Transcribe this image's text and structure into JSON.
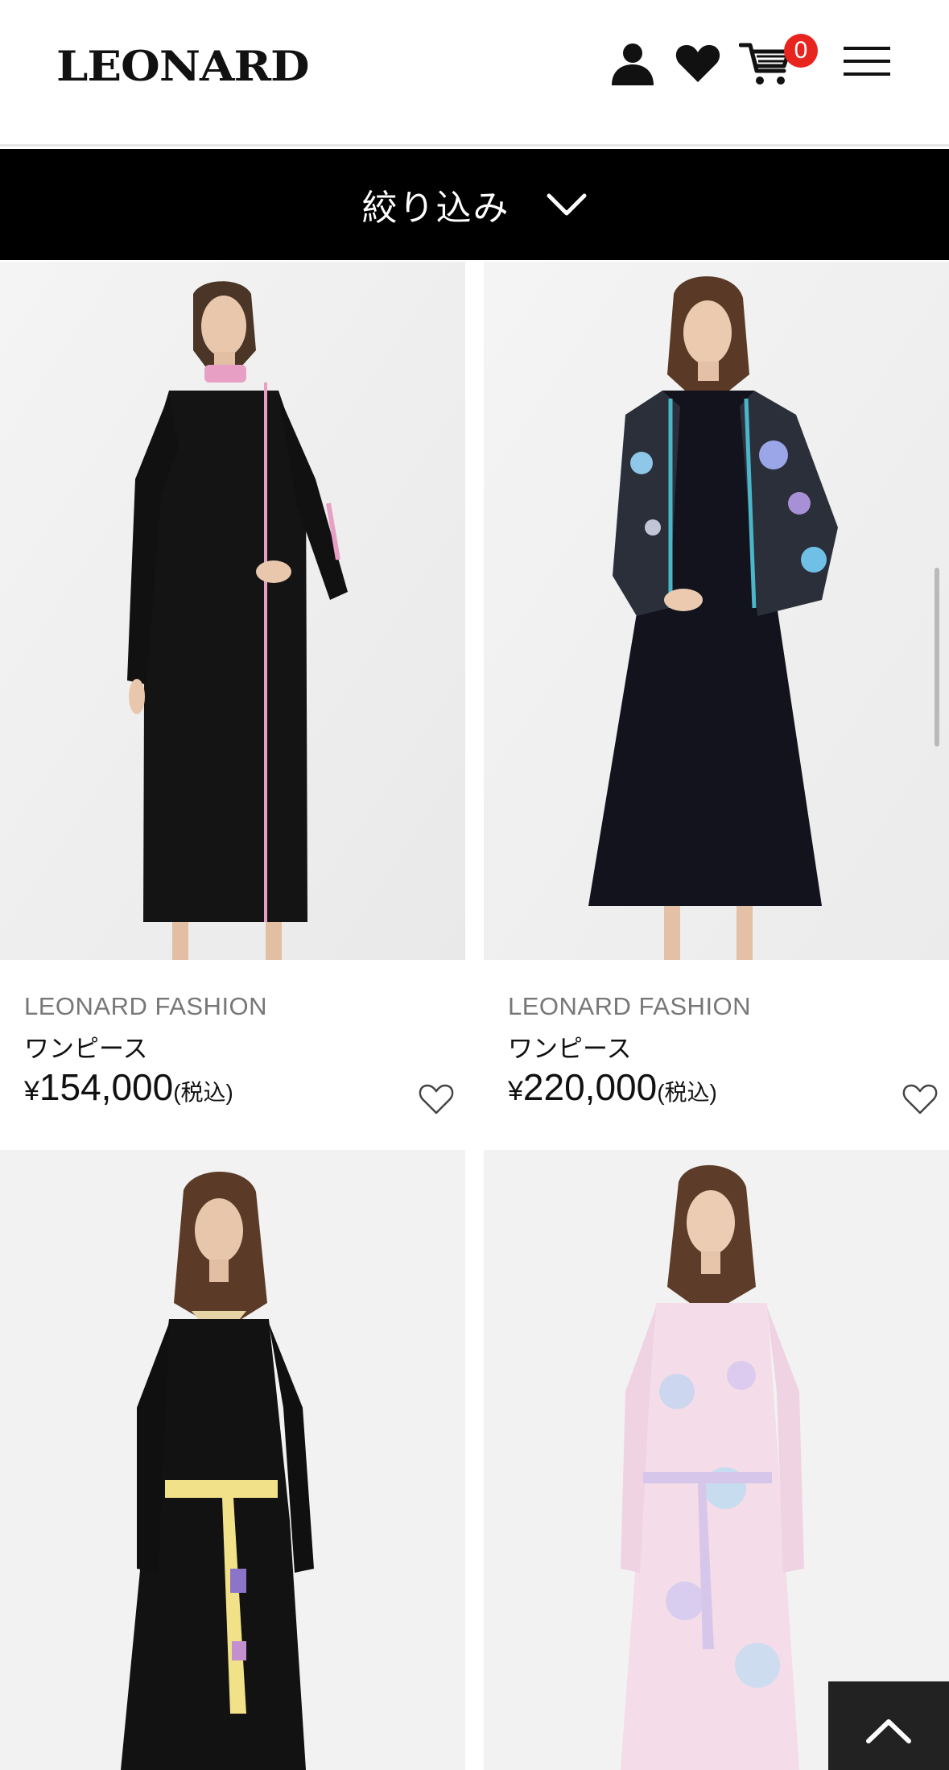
{
  "header": {
    "logo": "LEONARD",
    "cart_count": "0",
    "icons": [
      "user-icon",
      "heart-icon",
      "cart-icon",
      "menu-icon"
    ]
  },
  "filter": {
    "label": "絞り込み"
  },
  "products": [
    {
      "brand": "LEONARD FASHION",
      "name": "ワンピース",
      "price_symbol": "¥",
      "price": "154,000",
      "tax": "(税込)"
    },
    {
      "brand": "LEONARD FASHION",
      "name": "ワンピース",
      "price_symbol": "¥",
      "price": "220,000",
      "tax": "(税込)"
    },
    {
      "brand": "",
      "name": "",
      "price_symbol": "",
      "price": "",
      "tax": ""
    },
    {
      "brand": "",
      "name": "",
      "price_symbol": "",
      "price": "",
      "tax": ""
    }
  ],
  "colors": {
    "badge": "#e8241f",
    "filter_bar": "#000000",
    "to_top": "#222222"
  }
}
